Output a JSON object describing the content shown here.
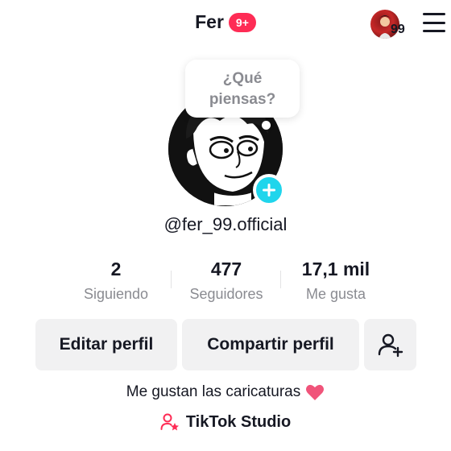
{
  "header": {
    "display_name": "Fer",
    "notification_badge": "9+",
    "avatar_count": "99"
  },
  "bubble": {
    "line1": "¿Qué",
    "line2": "piensas?"
  },
  "profile": {
    "username": "@fer_99.official",
    "bio": "Me gustan las caricaturas"
  },
  "stats": [
    {
      "value": "2",
      "label": "Siguiendo"
    },
    {
      "value": "477",
      "label": "Seguidores"
    },
    {
      "value": "17,1 mil",
      "label": "Me gusta"
    }
  ],
  "buttons": {
    "edit": "Editar perfil",
    "share": "Compartir perfil"
  },
  "studio": {
    "label": "TikTok Studio"
  },
  "colors": {
    "accent": "#fe2c55",
    "add_button": "#20d5ec",
    "muted_text": "#8a8b91",
    "button_bg": "#f1f1f2"
  }
}
